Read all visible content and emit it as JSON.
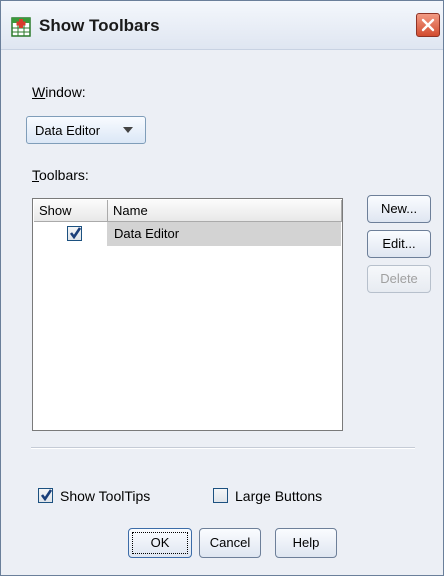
{
  "window": {
    "title": "Show Toolbars"
  },
  "window_field": {
    "label": "Window:",
    "selected": "Data Editor"
  },
  "toolbars": {
    "label": "Toolbars:",
    "columns": [
      "Show",
      "Name"
    ],
    "rows": [
      {
        "show": true,
        "name": "Data Editor",
        "selected": true
      }
    ]
  },
  "side_buttons": {
    "new": "New...",
    "edit": "Edit...",
    "delete": "Delete"
  },
  "options": {
    "show_tooltips": {
      "label": "Show ToolTips",
      "checked": true
    },
    "large_buttons": {
      "label": "Large Buttons",
      "checked": false
    }
  },
  "footer": {
    "ok": "OK",
    "cancel": "Cancel",
    "help": "Help"
  },
  "colors": {
    "title_bg": "#e6ecf5",
    "dialog_bg": "#eceff5",
    "close_red": "#d24c2f",
    "checkmark": "#1a3f7a",
    "row_selected": "#d3d3d3"
  }
}
